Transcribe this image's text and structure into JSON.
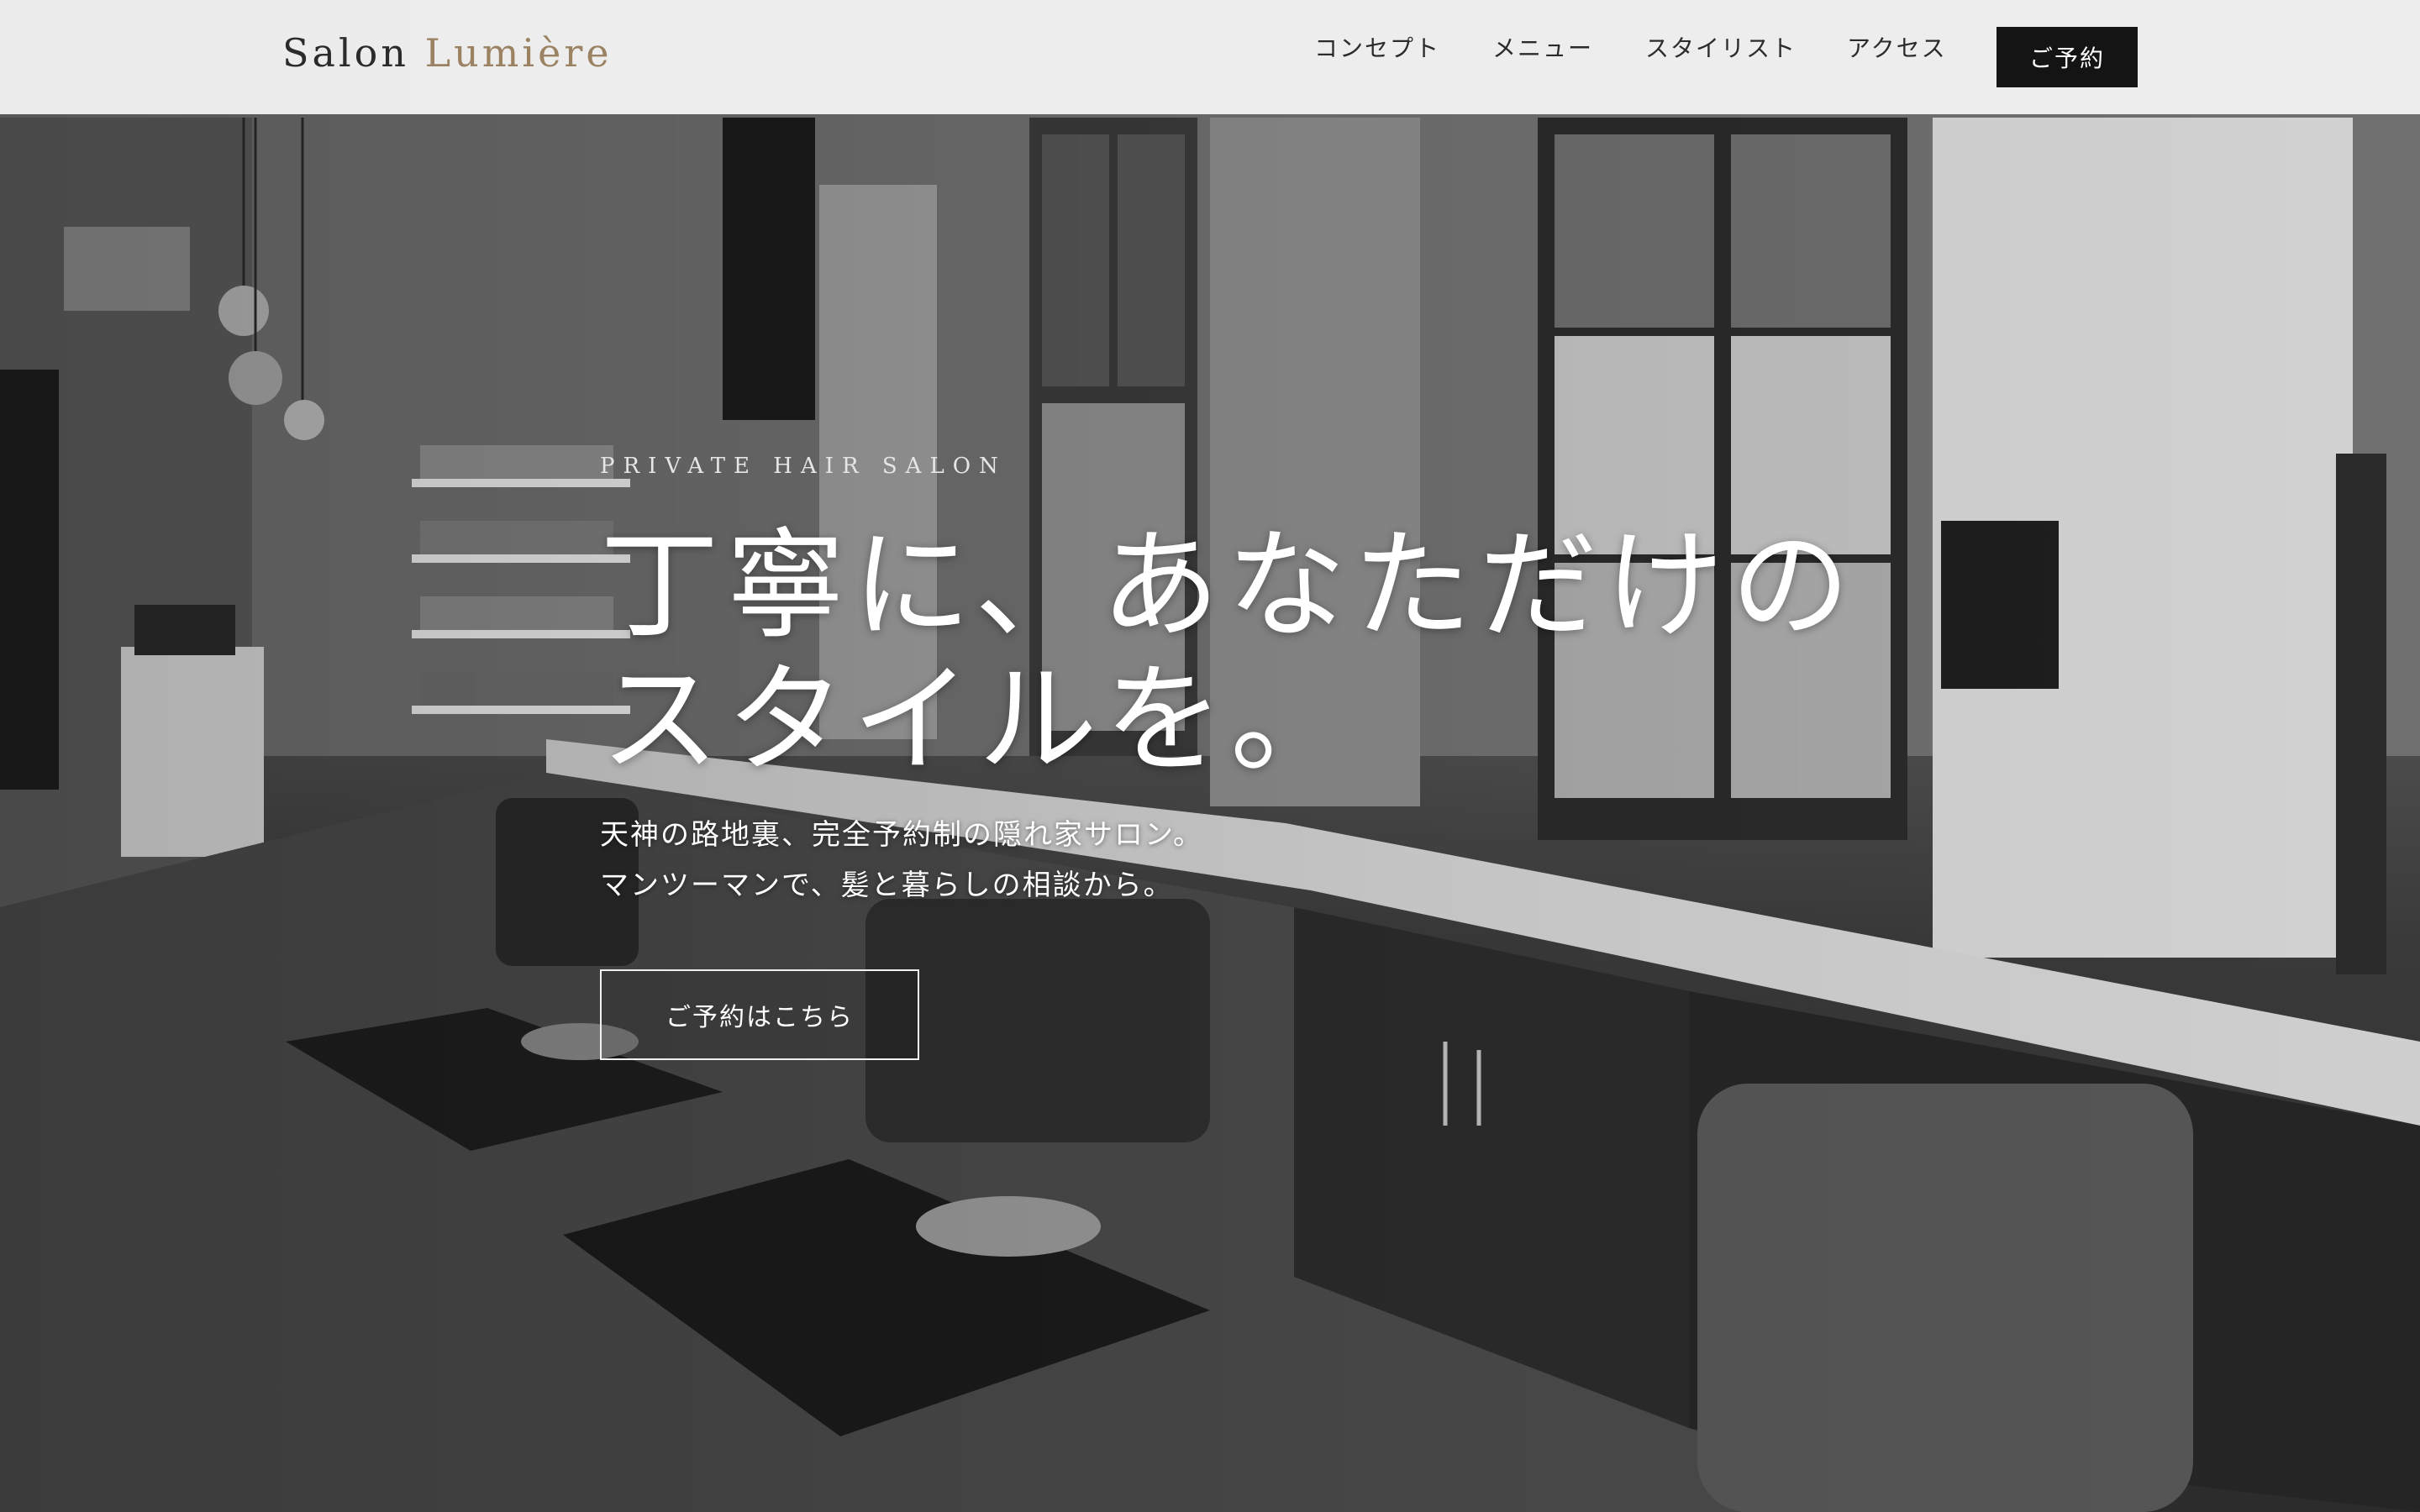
{
  "header": {
    "logo_primary": "Salon",
    "logo_accent": "Lumière",
    "nav": [
      {
        "label": "コンセプト"
      },
      {
        "label": "メニュー"
      },
      {
        "label": "スタイリスト"
      },
      {
        "label": "アクセス"
      }
    ],
    "reserve_label": "ご予約"
  },
  "hero": {
    "eyebrow": "PRIVATE HAIR SALON",
    "headline_line1": "丁寧に、あなただけの",
    "headline_line2": "スタイルを。",
    "sub_line1": "天神の路地裏、完全予約制の隠れ家サロン。",
    "sub_line2": "マンツーマンで、髪と暮らしの相談から。",
    "cta_label": "ご予約はこちら",
    "background_image": "monochrome-salon-interior"
  },
  "colors": {
    "header_bg": "#f3f3f3",
    "logo_accent": "#9a8262",
    "button_bg": "#141414",
    "text_light": "#ffffff"
  }
}
